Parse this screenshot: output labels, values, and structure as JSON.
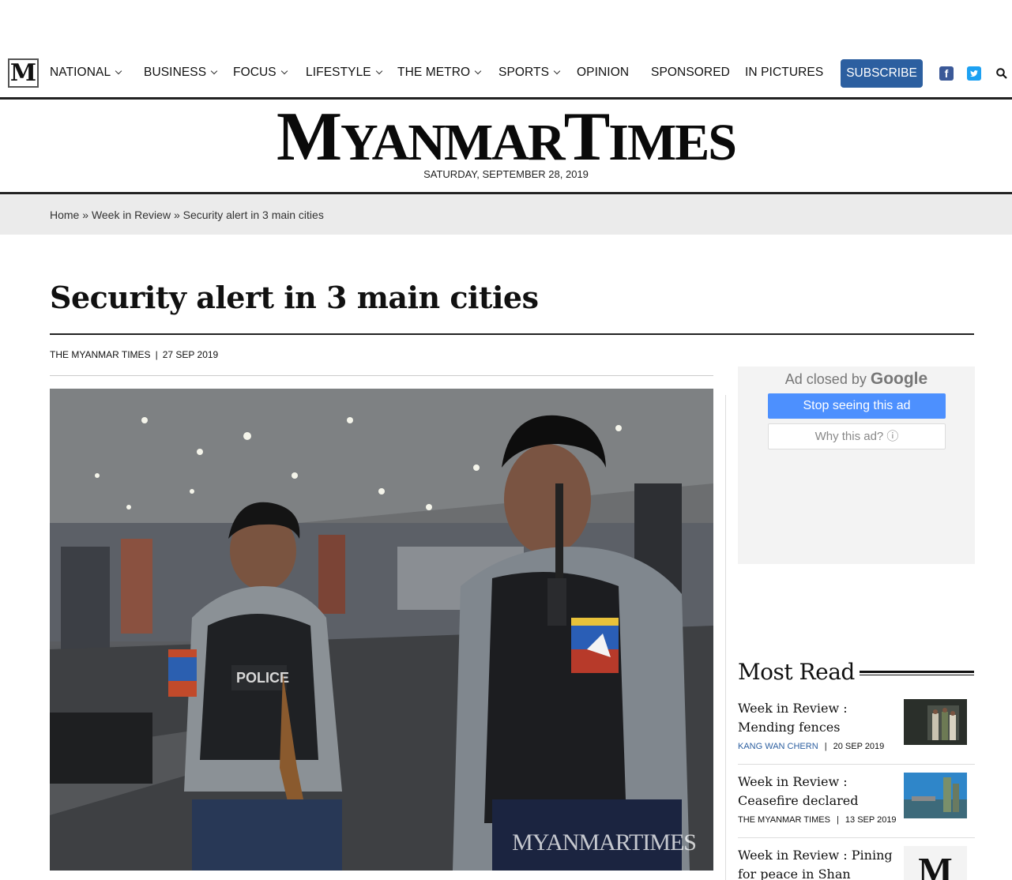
{
  "nav": {
    "logo_letter": "M",
    "items": [
      {
        "label": "NATIONAL",
        "dropdown": true
      },
      {
        "label": "BUSINESS",
        "dropdown": true
      },
      {
        "label": "FOCUS",
        "dropdown": true
      },
      {
        "label": "LIFESTYLE",
        "dropdown": true
      },
      {
        "label": "THE METRO",
        "dropdown": true
      },
      {
        "label": "SPORTS",
        "dropdown": true
      },
      {
        "label": "OPINION",
        "dropdown": false
      },
      {
        "label": "SPONSORED",
        "dropdown": false
      },
      {
        "label": "IN PICTURES",
        "dropdown": false
      }
    ],
    "subscribe_label": "SUBSCRIBE",
    "facebook_icon": "facebook-icon",
    "twitter_icon": "twitter-icon",
    "search_icon": "search-icon"
  },
  "masthead": {
    "part1_big": "M",
    "part1_rest": "YANMAR",
    "part2_big": "T",
    "part2_rest": "IMES",
    "date": "SATURDAY, SEPTEMBER 28, 2019"
  },
  "breadcrumb": {
    "home": "Home",
    "sep": "»",
    "section": "Week in Review",
    "current": "Security alert in 3 main cities"
  },
  "article": {
    "title": "Security alert in 3 main cities",
    "author": "THE MYANMAR TIMES",
    "separator": "|",
    "date": "27 SEP 2019",
    "photo_watermark": "MYANMARTIMES",
    "photo_patch_text": "POLICE"
  },
  "ad": {
    "closed_by": "Ad closed by",
    "google": "Google",
    "stop_label": "Stop seeing this ad",
    "why_label": "Why this ad? ⓘ"
  },
  "most_read": {
    "title": "Most Read",
    "items": [
      {
        "headline": "Week in Review : Mending fences",
        "author": "KANG WAN CHERN",
        "date": "20 SEP 2019",
        "author_colored": true
      },
      {
        "headline": "Week in Review : Ceasefire declared",
        "author": "THE MYANMAR TIMES",
        "date": "13 SEP 2019",
        "author_colored": false
      },
      {
        "headline": "Week in Review : Pining for peace in Shan",
        "thumb_letter": "M"
      }
    ]
  },
  "colors": {
    "accent": "#2c5fa0",
    "ad_button": "#4d90fe",
    "breadcrumb_bg": "#ebebeb"
  }
}
